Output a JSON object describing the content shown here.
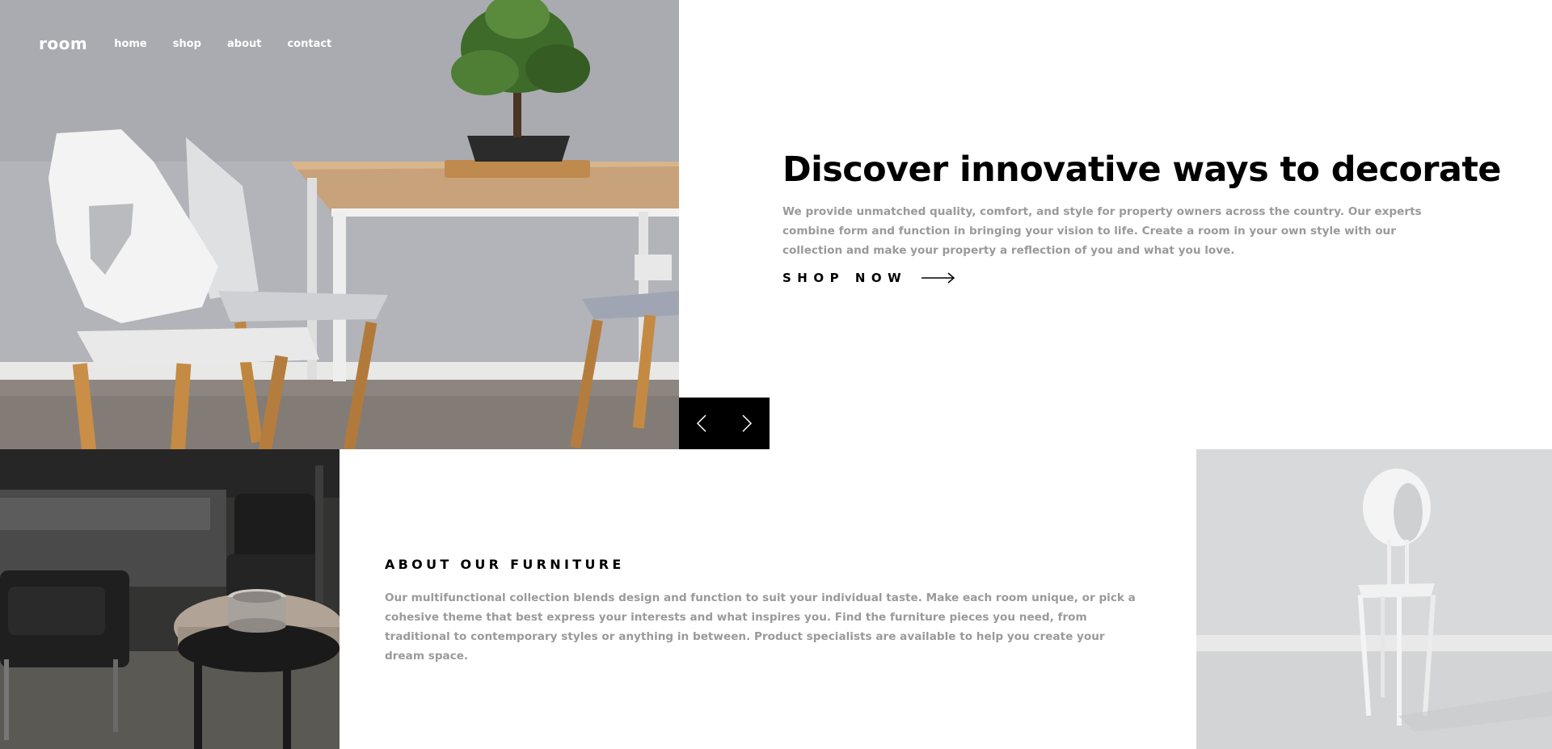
{
  "nav": {
    "logo": "room",
    "links": [
      "home",
      "shop",
      "about",
      "contact"
    ]
  },
  "hero": {
    "title": "Discover innovative ways to decorate",
    "description": "We provide unmatched quality, comfort, and style for property owners across the country. Our experts combine form and function in bringing your vision to life. Create a room in your own style with our collection and make your property a reflection of you and what you love.",
    "cta_label": "SHOP NOW"
  },
  "about": {
    "heading": "ABOUT OUR FURNITURE",
    "description": "Our multifunctional collection blends design and function to suit your individual taste. Make each room unique, or pick a cohesive theme that best express your interests and what inspires you. Find the furniture pieces you need, from traditional to contemporary styles or anything in between. Product specialists are available to help you create your dream space."
  },
  "colors": {
    "text": "#000000",
    "muted_text": "#9a9a9a",
    "slider_bg": "#000000",
    "background": "#ffffff"
  },
  "icons": {
    "slider_prev": "angle-left-icon",
    "slider_next": "angle-right-icon",
    "cta_arrow": "arrow-right-icon"
  }
}
